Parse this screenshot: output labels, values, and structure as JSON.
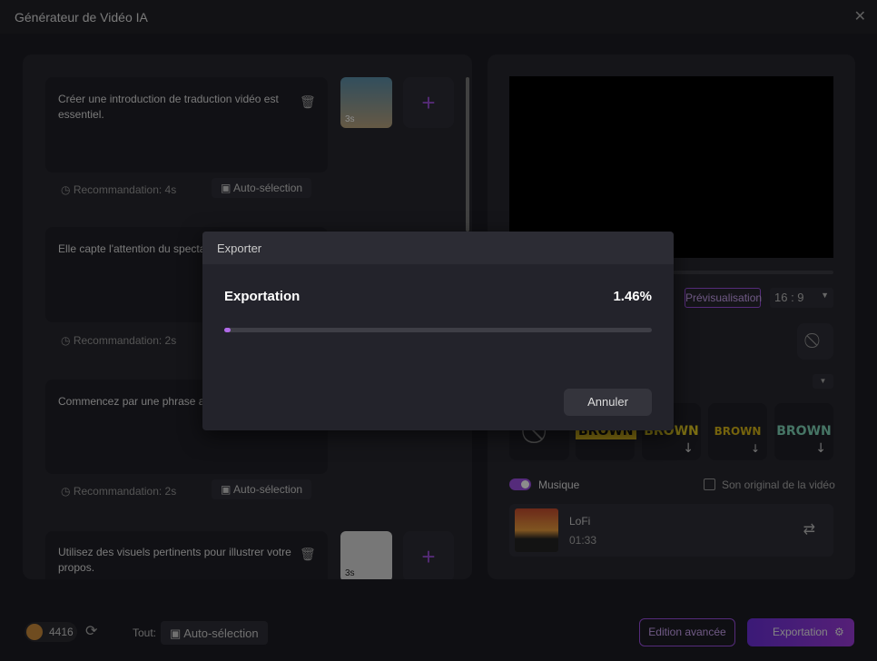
{
  "window": {
    "title": "Générateur de Vidéo IA",
    "close_icon": "close-icon"
  },
  "scenes": [
    {
      "text": "Créer une introduction de traduction vidéo est essentiel.",
      "recommendation": "Recommandation: 4s",
      "auto": "Auto-sélection",
      "duration": "3s"
    },
    {
      "text": "Elle capte l'attention du spectateur",
      "recommendation": "Recommandation: 2s",
      "auto": "",
      "duration": ""
    },
    {
      "text": "Commencez par une phrase accrocheuse",
      "recommendation": "Recommandation: 2s",
      "auto": "Auto-sélection",
      "duration": ""
    },
    {
      "text": "Utilisez des visuels pertinents pour illustrer votre propos.",
      "recommendation": "",
      "auto": "",
      "duration": "3s"
    }
  ],
  "preview": {
    "button": "Prévisualisation",
    "ratio": "16 : 9"
  },
  "styles": [
    "BROWN",
    "BROWN",
    "BROWN",
    "BROWN"
  ],
  "music": {
    "label": "Musique",
    "original_label": "Son original de la vidéo",
    "track": "LoFi",
    "duration": "01:33",
    "enabled": true,
    "original_checked": false
  },
  "footer": {
    "credits": "4416",
    "all_label": "Tout:",
    "auto": "Auto-sélection",
    "advanced": "Edition avancée",
    "export": "Exportation"
  },
  "modal": {
    "title": "Exporter",
    "label": "Exportation",
    "percent_text": "1.46%",
    "progress": 1.46,
    "cancel": "Annuler"
  },
  "colors": {
    "accent": "#9b4fe0"
  }
}
